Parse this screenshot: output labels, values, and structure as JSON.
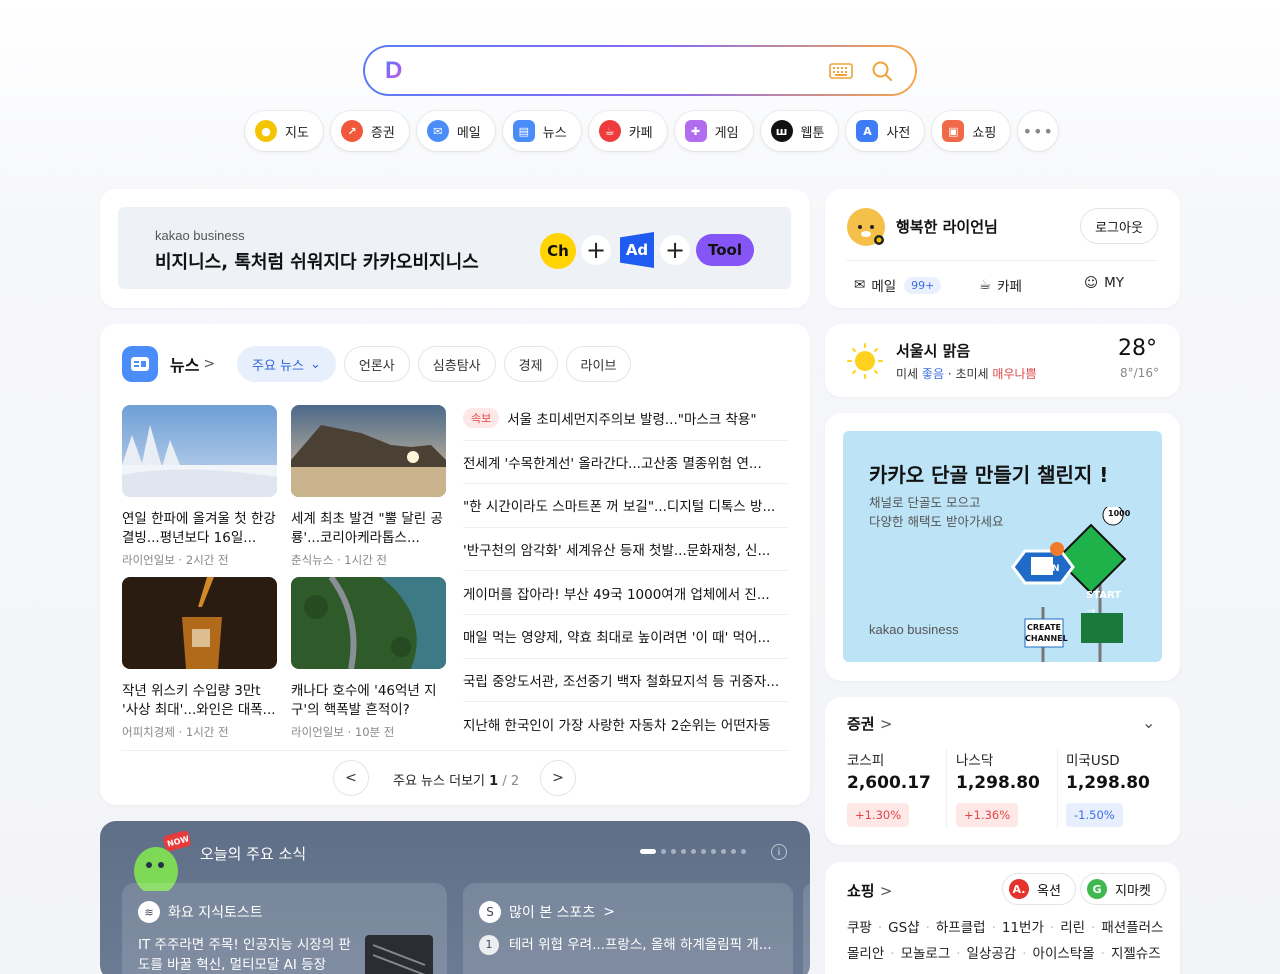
{
  "search": {
    "logo": "D",
    "placeholder": ""
  },
  "shortcuts": [
    {
      "label": "지도",
      "icon": "map-pin-icon",
      "color": "#f5c400"
    },
    {
      "label": "증권",
      "icon": "stock-chart-icon",
      "color": "#f0573b"
    },
    {
      "label": "메일",
      "icon": "mail-icon",
      "color": "#4b8df8"
    },
    {
      "label": "뉴스",
      "icon": "news-icon",
      "color": "#4b8df8"
    },
    {
      "label": "카페",
      "icon": "cafe-icon",
      "color": "#ee3b3b"
    },
    {
      "label": "게임",
      "icon": "game-icon",
      "color": "#b26cf0"
    },
    {
      "label": "웹툰",
      "icon": "webtoon-icon",
      "color": "#111111"
    },
    {
      "label": "사전",
      "icon": "dictionary-icon",
      "color": "#3d7cf5"
    },
    {
      "label": "쇼핑",
      "icon": "shopping-bag-icon",
      "color": "#f06a4a"
    }
  ],
  "banner": {
    "sub": "kakao business",
    "main": "비지니스, 톡처럼 쉬워지다 카카오비지니스",
    "badge_ch": "Ch",
    "badge_ad": "Ad",
    "badge_tool": "Tool",
    "plus": "+"
  },
  "news": {
    "title": "뉴스",
    "chips": [
      "주요 뉴스",
      "언론사",
      "심층탐사",
      "경제",
      "라이브"
    ],
    "cards": [
      {
        "title": "연일 한파에 올겨울 첫 한강 결빙...평년보다 16일...",
        "source": "라이언일보",
        "time": "2시간 전"
      },
      {
        "title": "세계 최초 발견 \"뿔 달린 공룡'...코리아케라톱스...",
        "source": "춘식뉴스",
        "time": "1시간 전"
      },
      {
        "title": "작년 위스키 수입량 3만t '사상 최대'...와인은 대폭...",
        "source": "어피치경제",
        "time": "1시간 전"
      },
      {
        "title": "캐나다 호수에 '46억년 지구'의 핵폭발 흔적이?",
        "source": "라이언일보",
        "time": "10분 전"
      }
    ],
    "breaking_label": "속보",
    "list": [
      "서울 초미세먼지주의보 발령...\"마스크 착용\"",
      "전세계 '수목한계선' 올라간다...고산종 멸종위험 연...",
      "\"한 시간이라도 스마트폰 꺼 보길\"...디지털 디톡스 방...",
      "'반구천의 암각화' 세계유산 등재 첫발...문화재청, 신...",
      "게이머를 잡아라! 부산 49국 1000여개 업체에서 진...",
      "매일 먹는 영양제, 약효 최대로 높이려면 '이 때' 먹어...",
      "국립 중앙도서관, 조선중기 백자 철화묘지석 등 귀중자...",
      "지난해 한국인이 가장 사랑한 자동차 2순위는 어떤자동"
    ],
    "more_label": "주요 뉴스 더보기",
    "page": "1",
    "total": "/ 2"
  },
  "today": {
    "title": "오늘의 주요 소식",
    "now_badge": "NOW",
    "cards": [
      {
        "head": "화요 지식토스트",
        "body": "IT 주주라면 주목! 인공지능 시장의 판도를 바꿀 혁신, 멀티모달 AI 등장"
      },
      {
        "head": "많이 본 스포츠",
        "rank": "1",
        "body": "테러 위협 우려...프랑스, 올해 하계올림픽 개..."
      }
    ]
  },
  "profile": {
    "name": "행복한 라이언님",
    "logout": "로그아웃",
    "mail": "메일",
    "mail_count": "99+",
    "cafe": "카페",
    "my": "MY"
  },
  "weather": {
    "location": "서울시 맑음",
    "dust_label": "미세",
    "dust_value": "좋음",
    "fine_dust_label": "초미세",
    "fine_dust_value": "매우나쁨",
    "temp": "28°",
    "range": "8°/16°"
  },
  "ad": {
    "title": "카카오 단골 만들기 챌린지 !",
    "sub1": "채널로 단골도 모으고",
    "sub2": "다양한 해택도 받아가세요",
    "brand": "kakao business",
    "sign_start": "START",
    "sign_create": "CREATE",
    "sign_channel": "CHANNEL",
    "sign_num": "1000",
    "sign_n": "N"
  },
  "stocks": {
    "title": "증권",
    "items": [
      {
        "name": "코스피",
        "value": "2,600.17",
        "change": "+1.30%",
        "dir": "up"
      },
      {
        "name": "나스닥",
        "value": "1,298.80",
        "change": "+1.36%",
        "dir": "up"
      },
      {
        "name": "미국USD",
        "value": "1,298.80",
        "change": "-1.50%",
        "dir": "down"
      }
    ]
  },
  "shopping": {
    "title": "쇼핑",
    "partners": [
      {
        "label": "옥션",
        "icon": "A.",
        "color": "#e5322d"
      },
      {
        "label": "지마켓",
        "icon": "G",
        "color": "#3fb850"
      }
    ],
    "keywords": [
      "쿠팡",
      "GS샵",
      "하프클럽",
      "11번가",
      "리린",
      "패션플러스",
      "몰리안",
      "모놀로그",
      "일상공감",
      "아이스탁몰",
      "지젤슈즈"
    ]
  }
}
